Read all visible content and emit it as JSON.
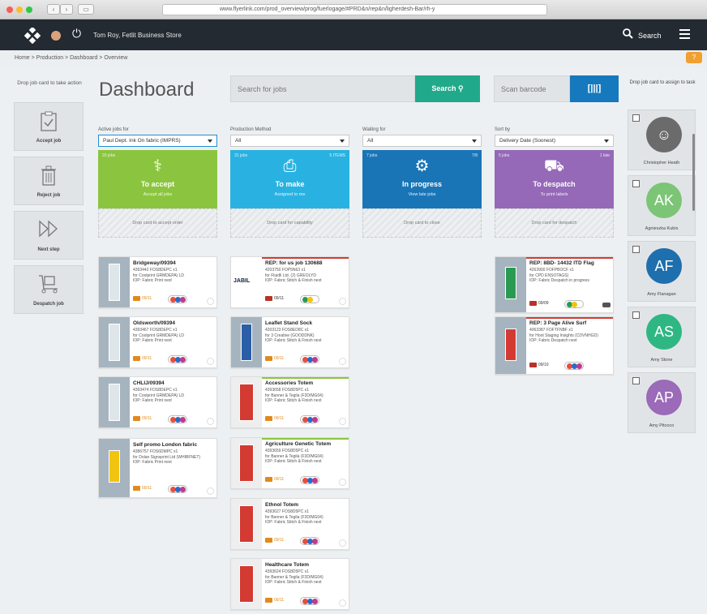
{
  "browser": {
    "url": "www.flyerlink.com/prod_overview/prog/fuerlogage/#PRD&n/rep&n/ligherdesh-Bar/rh-y"
  },
  "header": {
    "user": "Tom Roy, Fetlit Business Store",
    "search_label": "Search"
  },
  "breadcrumb": "Home  >  Production  >  Dashboard  >  Overview",
  "page_title": "Dashboard",
  "search": {
    "placeholder": "Search for jobs",
    "button": "Search"
  },
  "scan": {
    "placeholder": "Scan barcode",
    "button": "[|||]"
  },
  "left_actions": {
    "hint": "Drop job card to take action",
    "items": [
      {
        "label": "Accept job"
      },
      {
        "label": "Reject job"
      },
      {
        "label": "Next step"
      },
      {
        "label": "Despatch job"
      }
    ]
  },
  "columns": [
    {
      "filter_label": "Active jobs for",
      "filter_value": "Paul Dept. Ink On fabric (IMPRS)",
      "count": "20 jobs",
      "stage": "To accept",
      "sub": "Accept all jobs",
      "drop": "Drop card to accept order",
      "color": "#8bc53f"
    },
    {
      "filter_label": "Production Method",
      "filter_value": "All",
      "count": "31 jobs",
      "count2": "5 ITEMS",
      "stage": "To make",
      "sub": "Assigned to me",
      "drop": "Drop card for capability",
      "color": "#29b2e1"
    },
    {
      "filter_label": "Waiting for",
      "filter_value": "All",
      "count": "7 jobs",
      "count2": "7/8",
      "stage": "In progress",
      "sub": "View late jobs",
      "drop": "Drop card to close",
      "color": "#1a75b7"
    },
    {
      "filter_label": "Sort by",
      "filter_value": "Delivery Date (Soonest)",
      "count": "5 jobs",
      "count2": "1 late",
      "stage": "To despatch",
      "sub": "To print labels",
      "drop": "Drop card for despatch",
      "color": "#9569b7"
    }
  ],
  "cards": {
    "col1": [
      {
        "title": "Bridgeway/09394",
        "l1": "4393442 FOS8DEPC x1",
        "l2": "for Coolprint GRMDEPA) LD",
        "l3": "IOP: Fabric Print next",
        "date": "09/11"
      },
      {
        "title": "Oldsworth/09394",
        "l1": "4393467 FOS8DEPC x1",
        "l2": "for Coolprint GRMDEPA) LD",
        "l3": "IOP: Fabric Print next",
        "date": "09/11"
      },
      {
        "title": "CHLIJ/09394",
        "l1": "4393474 FOS8DEPC x1",
        "l2": "for Coolprint GRMDEPA) LD",
        "l3": "IOP: Fabric Print next",
        "date": "09/11"
      },
      {
        "title": "Self promo London fabric",
        "l1": "4386757 FOS6DMPC x1",
        "l2": "for Dolan Signsprint Ltd (WHIBFNET)",
        "l3": "IOP: Fabric Print next",
        "date": "09/11"
      }
    ],
    "col2": [
      {
        "title": "REP: for us job 130688",
        "l1": "4203750 FOP5N63 x1",
        "l2": "for Fluidli Ltd. (2) GREOLYD",
        "l3": "IOP: Fabric Stitch & Finish next",
        "date": "09/11"
      },
      {
        "title": "Leaflet Stand Sock",
        "l1": "4203123 FOS8ED8C x1",
        "l2": "for 3 Creative (GOODDNK)",
        "l3": "IOP: Fabric Stitch & Finish next",
        "date": "09/11"
      },
      {
        "title": "Accessories Totem",
        "l1": "4393658 FOS8D5PC x1",
        "l2": "for Banner & Tegila (F3D/MG04)",
        "l3": "IOP: Fabric Stitch & Finish next",
        "date": "09/11"
      },
      {
        "title": "Agriculture Genetic Totem",
        "l1": "4393659 FOS8D5PC x1",
        "l2": "for Banner & Tegila (F3D/MG04)",
        "l3": "IOP: Fabric Stitch & Finish next",
        "date": "09/11"
      },
      {
        "title": "Ethnol Totem",
        "l1": "4393627 FOS8D5PC x1",
        "l2": "for Banner & Tegila (F3D/MG04)",
        "l3": "IOP: Fabric Stitch & Finish next",
        "date": "09/11"
      },
      {
        "title": "Healthcare Totem",
        "l1": "4393624 FOS8D5PC x1",
        "l2": "for Banner & Tegila (F3D/MG04)",
        "l3": "IOP: Fabric Stitch & Finish next",
        "date": "09/11"
      }
    ],
    "col4": [
      {
        "title": "REP: 8BD- 14432 ITD Flag",
        "l1": "4263900 FOFPBOCF x1",
        "l2": "for CPD ENSOTAGS)",
        "l3": "IOP: Fabric Despatch in progress",
        "date": "09/09"
      },
      {
        "title": "REP: 3 Page Alive Surf",
        "l1": "4063387 FOFTFNBF x1",
        "l2": "for Hoot Staging Insights (CDVNHGD)",
        "l3": "IOP: Fabric Despatch next",
        "date": "09/10"
      }
    ]
  },
  "assign": {
    "hint": "Drop job card to assign to task",
    "people": [
      {
        "initials": "",
        "name": "Christopher Heath",
        "color": "#6b6b6b"
      },
      {
        "initials": "AK",
        "name": "Agnieszka Kubis",
        "color": "#7cc576"
      },
      {
        "initials": "AF",
        "name": "Amy Flanagan",
        "color": "#1e6fae"
      },
      {
        "initials": "AS",
        "name": "Amy Stone",
        "color": "#2fb783"
      },
      {
        "initials": "AP",
        "name": "Amy Pitcoco",
        "color": "#9b6ab8"
      }
    ]
  }
}
